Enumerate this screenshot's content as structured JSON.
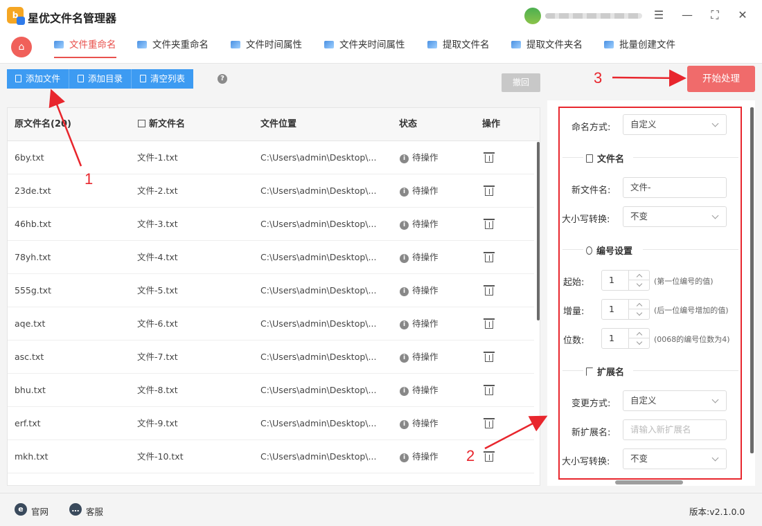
{
  "app": {
    "title": "星优文件名管理器",
    "logo_text": "b a"
  },
  "window_controls": [
    "settings-sliders-icon",
    "minimize-icon",
    "maximize-icon",
    "close-icon"
  ],
  "tabs": [
    {
      "label": "文件重命名",
      "active": true
    },
    {
      "label": "文件夹重命名",
      "active": false
    },
    {
      "label": "文件时间属性",
      "active": false
    },
    {
      "label": "文件夹时间属性",
      "active": false
    },
    {
      "label": "提取文件名",
      "active": false
    },
    {
      "label": "提取文件夹名",
      "active": false
    },
    {
      "label": "批量创建文件",
      "active": false
    }
  ],
  "toolbar": {
    "add_file": "添加文件",
    "add_dir": "添加目录",
    "clear_list": "清空列表",
    "help": "?",
    "undo": "撤回",
    "start": "开始处理"
  },
  "table": {
    "headers": {
      "original": "原文件名(20)",
      "new": "新文件名",
      "location": "文件位置",
      "status": "状态",
      "action": "操作"
    },
    "rows": [
      {
        "original": "6by.txt",
        "new": "文件-1.txt",
        "location": "C:\\Users\\admin\\Desktop\\...",
        "status": "待操作"
      },
      {
        "original": "23de.txt",
        "new": "文件-2.txt",
        "location": "C:\\Users\\admin\\Desktop\\...",
        "status": "待操作"
      },
      {
        "original": "46hb.txt",
        "new": "文件-3.txt",
        "location": "C:\\Users\\admin\\Desktop\\...",
        "status": "待操作"
      },
      {
        "original": "78yh.txt",
        "new": "文件-4.txt",
        "location": "C:\\Users\\admin\\Desktop\\...",
        "status": "待操作"
      },
      {
        "original": "555g.txt",
        "new": "文件-5.txt",
        "location": "C:\\Users\\admin\\Desktop\\...",
        "status": "待操作"
      },
      {
        "original": "aqe.txt",
        "new": "文件-6.txt",
        "location": "C:\\Users\\admin\\Desktop\\...",
        "status": "待操作"
      },
      {
        "original": "asc.txt",
        "new": "文件-7.txt",
        "location": "C:\\Users\\admin\\Desktop\\...",
        "status": "待操作"
      },
      {
        "original": "bhu.txt",
        "new": "文件-8.txt",
        "location": "C:\\Users\\admin\\Desktop\\...",
        "status": "待操作"
      },
      {
        "original": "erf.txt",
        "new": "文件-9.txt",
        "location": "C:\\Users\\admin\\Desktop\\...",
        "status": "待操作"
      },
      {
        "original": "mkh.txt",
        "new": "文件-10.txt",
        "location": "C:\\Users\\admin\\Desktop\\...",
        "status": "待操作"
      }
    ]
  },
  "settings": {
    "naming_mode_label": "命名方式:",
    "naming_mode_value": "自定义",
    "filename_section": "文件名",
    "new_name_label": "新文件名:",
    "new_name_value": "文件-",
    "case_label": "大小写转换:",
    "case_value": "不变",
    "numbering_section": "编号设置",
    "start_label": "起始:",
    "start_value": "1",
    "start_hint": "(第一位编号的值)",
    "step_label": "增量:",
    "step_value": "1",
    "step_hint": "(后一位编号增加的值)",
    "digits_label": "位数:",
    "digits_value": "1",
    "digits_hint": "(0068的编号位数为4)",
    "ext_section": "扩展名",
    "ext_mode_label": "变更方式:",
    "ext_mode_value": "自定义",
    "new_ext_label": "新扩展名:",
    "new_ext_placeholder": "请输入新扩展名",
    "ext_case_label": "大小写转换:",
    "ext_case_value": "不变"
  },
  "statusbar": {
    "website": "官网",
    "support": "客服",
    "version": "版本:v2.1.0.0"
  },
  "annotations": {
    "n1": "1",
    "n2": "2",
    "n3": "3",
    "color": "#e8262d"
  },
  "colors": {
    "accent_red": "#e8514d",
    "toolbar_blue": "#3d9bf2",
    "start_button": "#f06b6b"
  }
}
